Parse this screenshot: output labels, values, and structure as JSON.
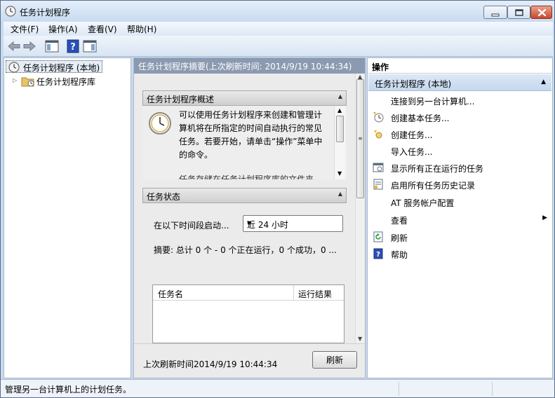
{
  "window": {
    "title": "任务计划程序"
  },
  "menu": {
    "file": "文件(F)",
    "action": "操作(A)",
    "view": "查看(V)",
    "help": "帮助(H)"
  },
  "tree": {
    "root_label": "任务计划程序 (本地)",
    "library_label": "任务计划程序库"
  },
  "center": {
    "header": "任务计划程序摘要(上次刷新时间: 2014/9/19 10:44:34)",
    "overview": {
      "title": "任务计划程序概述",
      "text": "可以使用任务计划程序来创建和管理计算机将在所指定的时间自动执行的常见任务。若要开始，请单击“操作”菜单中的命令。",
      "more": "任务存储在任务计划程序库的文件夹"
    },
    "status": {
      "title": "任务状态",
      "period_label": "在以下时间段启动...",
      "period_value": "近 24 小时",
      "summary": "摘要: 总计 0 个 - 0 个正在运行，0 个成功，0 ...",
      "columns": [
        "任务名",
        "运行结果"
      ]
    },
    "footer": {
      "last_refresh": "上次刷新时间2014/9/19 10:44:34",
      "refresh_button": "刷新"
    }
  },
  "actions": {
    "header": "操作",
    "group_title": "任务计划程序 (本地)",
    "items": [
      {
        "label": "连接到另一台计算机...",
        "icon": "none"
      },
      {
        "label": "创建基本任务...",
        "icon": "basic-task-icon"
      },
      {
        "label": "创建任务...",
        "icon": "create-task-icon"
      },
      {
        "label": "导入任务...",
        "icon": "none"
      },
      {
        "label": "显示所有正在运行的任务",
        "icon": "running-tasks-icon"
      },
      {
        "label": "启用所有任务历史记录",
        "icon": "history-icon"
      },
      {
        "label": "AT 服务帐户配置",
        "icon": "none"
      },
      {
        "label": "查看",
        "icon": "none"
      },
      {
        "label": "刷新",
        "icon": "refresh-icon"
      },
      {
        "label": "帮助",
        "icon": "help-icon"
      }
    ]
  },
  "statusbar": {
    "text": "管理另一台计算机上的计划任务。"
  }
}
